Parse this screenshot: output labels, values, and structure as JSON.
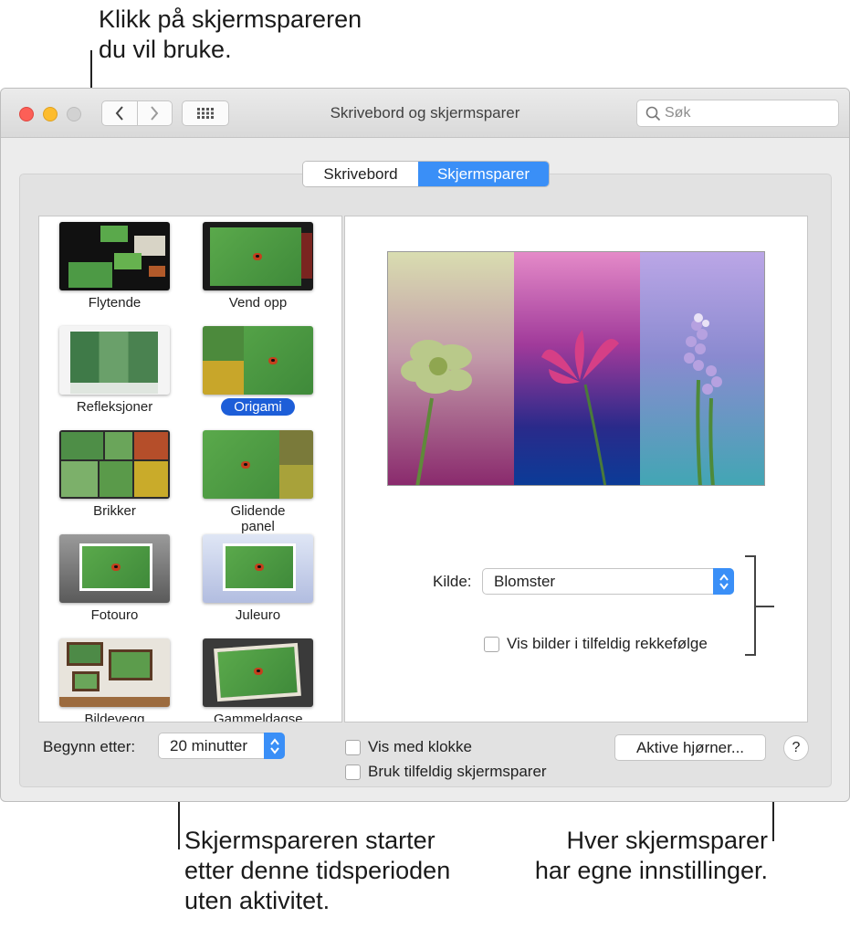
{
  "callouts": {
    "top_lines": [
      "Klikk på skjermspareren",
      "du vil bruke."
    ],
    "bottom_left_lines": [
      "Skjermspareren starter",
      "etter denne tidsperioden",
      "uten aktivitet."
    ],
    "bottom_right_lines": [
      "Hver skjermsparer",
      "har egne innstillinger."
    ]
  },
  "window": {
    "title": "Skrivebord og skjermsparer",
    "search_placeholder": "Søk"
  },
  "tabs": [
    {
      "label": "Skrivebord",
      "selected": false
    },
    {
      "label": "Skjermsparer",
      "selected": true
    }
  ],
  "screensavers": [
    {
      "label": "Flytende",
      "selected": false
    },
    {
      "label": "Vend opp",
      "selected": false
    },
    {
      "label": "Refleksjoner",
      "selected": false
    },
    {
      "label": "Origami",
      "selected": true
    },
    {
      "label": "Brikker",
      "selected": false
    },
    {
      "label": "Glidende panel",
      "selected": false
    },
    {
      "label": "Fotouro",
      "selected": false
    },
    {
      "label": "Juleuro",
      "selected": false
    },
    {
      "label": "Bildevegg",
      "selected": false
    },
    {
      "label": "Gammeldagse bilder",
      "selected": false
    }
  ],
  "options": {
    "source_label": "Kilde:",
    "source_value": "Blomster",
    "shuffle_label": "Vis bilder i tilfeldig rekkefølge",
    "shuffle_checked": false
  },
  "bottom_bar": {
    "start_after_label": "Begynn etter:",
    "start_after_value": "20 minutter",
    "show_clock_label": "Vis med klokke",
    "show_clock_checked": false,
    "random_label": "Bruk tilfeldig skjermsparer",
    "random_checked": false,
    "hot_corners_label": "Aktive hjørner...",
    "help_label": "?"
  },
  "colors": {
    "accent": "#3a8ff7",
    "selection": "#1d5ed8"
  }
}
